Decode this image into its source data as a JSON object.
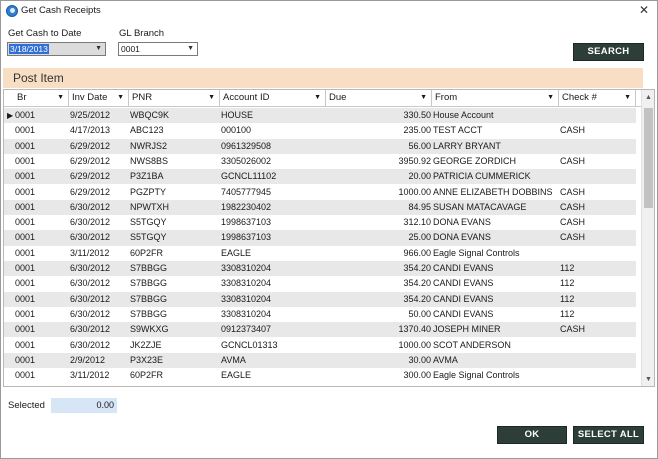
{
  "window": {
    "title": "Get Cash Receipts",
    "close_glyph": "✕"
  },
  "filters": {
    "date_label": "Get Cash to Date",
    "date_value": "3/18/2013",
    "branch_label": "GL Branch",
    "branch_value": "0001",
    "search_label": "SEARCH"
  },
  "section": {
    "title": "Post Item"
  },
  "grid": {
    "columns": [
      "Br",
      "Inv Date",
      "PNR",
      "Account ID",
      "Due",
      "From",
      "Check #"
    ],
    "rows": [
      [
        "0001",
        "9/25/2012",
        "WBQC9K",
        "HOUSE",
        "330.50",
        "House Account",
        ""
      ],
      [
        "0001",
        "4/17/2013",
        "ABC123",
        "000100",
        "235.00",
        "TEST ACCT",
        "CASH"
      ],
      [
        "0001",
        "6/29/2012",
        "NWRJS2",
        "0961329508",
        "56.00",
        "LARRY BRYANT",
        ""
      ],
      [
        "0001",
        "6/29/2012",
        "NWS8BS",
        "3305026002",
        "3950.92",
        "GEORGE ZORDICH",
        "CASH"
      ],
      [
        "0001",
        "6/29/2012",
        "P3Z1BA",
        "GCNCL11102",
        "20.00",
        "PATRICIA CUMMERICK",
        ""
      ],
      [
        "0001",
        "6/29/2012",
        "PGZPTY",
        "7405777945",
        "1000.00",
        "ANNE ELIZABETH DOBBINS",
        "CASH"
      ],
      [
        "0001",
        "6/30/2012",
        "NPWTXH",
        "1982230402",
        "84.95",
        "SUSAN MATACAVAGE",
        "CASH"
      ],
      [
        "0001",
        "6/30/2012",
        "S5TGQY",
        "1998637103",
        "312.10",
        "DONA EVANS",
        "CASH"
      ],
      [
        "0001",
        "6/30/2012",
        "S5TGQY",
        "1998637103",
        "25.00",
        "DONA EVANS",
        "CASH"
      ],
      [
        "0001",
        "3/11/2012",
        "60P2FR",
        "EAGLE",
        "966.00",
        "Eagle Signal Controls",
        ""
      ],
      [
        "0001",
        "6/30/2012",
        "S7BBGG",
        "3308310204",
        "354.20",
        "CANDI EVANS",
        "112"
      ],
      [
        "0001",
        "6/30/2012",
        "S7BBGG",
        "3308310204",
        "354.20",
        "CANDI EVANS",
        "112"
      ],
      [
        "0001",
        "6/30/2012",
        "S7BBGG",
        "3308310204",
        "354.20",
        "CANDI EVANS",
        "112"
      ],
      [
        "0001",
        "6/30/2012",
        "S7BBGG",
        "3308310204",
        "50.00",
        "CANDI EVANS",
        "112"
      ],
      [
        "0001",
        "6/30/2012",
        "S9WKXG",
        "0912373407",
        "1370.40",
        "JOSEPH MINER",
        "CASH"
      ],
      [
        "0001",
        "6/30/2012",
        "JK2ZJE",
        "GCNCL01313",
        "1000.00",
        "SCOT ANDERSON",
        ""
      ],
      [
        "0001",
        "2/9/2012",
        "P3X23E",
        "AVMA",
        "30.00",
        "AVMA",
        ""
      ],
      [
        "0001",
        "3/11/2012",
        "60P2FR",
        "EAGLE",
        "300.00",
        "Eagle Signal Controls",
        ""
      ]
    ],
    "current_row_glyph": "▶",
    "sort_glyph": "▼"
  },
  "footer": {
    "selected_label": "Selected",
    "selected_value": "0.00",
    "ok_label": "OK",
    "select_all_label": "SELECT ALL"
  },
  "colors": {
    "section_bg": "#f8dfc4",
    "button_bg": "#2c3e37",
    "selection_blue": "#2f6fd6",
    "selected_field_bg": "#d7e6f7",
    "alt_row": "#e8e8e8"
  },
  "icons": {
    "app": "app-globe-icon",
    "close": "close-icon",
    "dropdown": "chevron-down-icon",
    "row_pointer": "current-row-icon",
    "scroll_up": "scroll-up-icon",
    "scroll_down": "scroll-down-icon"
  }
}
